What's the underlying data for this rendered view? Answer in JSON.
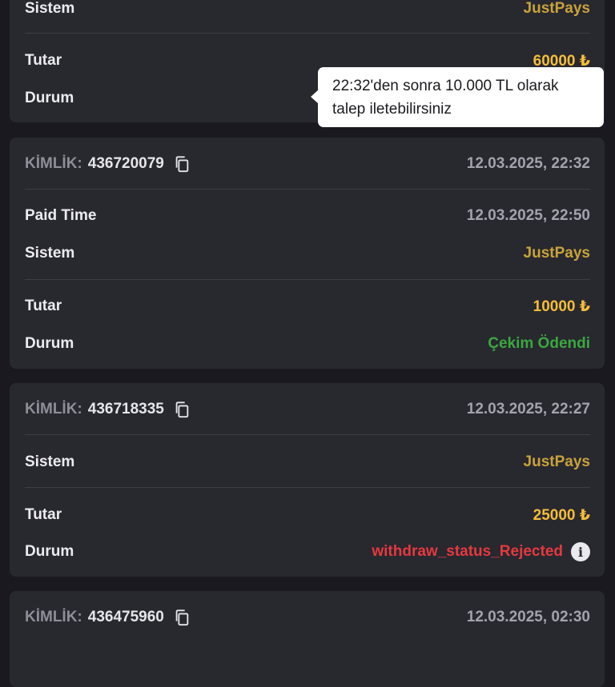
{
  "labels": {
    "id_label": "KİMLİK:",
    "sistem": "Sistem",
    "tutar": "Tutar",
    "durum": "Durum",
    "paid_time": "Paid Time"
  },
  "tooltip": {
    "text": "22:32'den sonra 10.000 TL olarak talep iletebilirsiniz"
  },
  "transactions": [
    {
      "system": "JustPays",
      "amount": "60000 ₺"
    },
    {
      "id": "436720079",
      "date": "12.03.2025, 22:32",
      "paid_time": "12.03.2025, 22:50",
      "system": "JustPays",
      "amount": "10000 ₺",
      "status": "Çekim Ödendi",
      "status_color": "#3aa83f"
    },
    {
      "id": "436718335",
      "date": "12.03.2025, 22:27",
      "system": "JustPays",
      "amount": "25000 ₺",
      "status": "withdraw_status_Rejected",
      "status_color": "#e5393e"
    },
    {
      "id": "436475960",
      "date": "12.03.2025, 02:30"
    }
  ],
  "icons": {
    "copy": "copy-icon",
    "info": "info-icon"
  }
}
